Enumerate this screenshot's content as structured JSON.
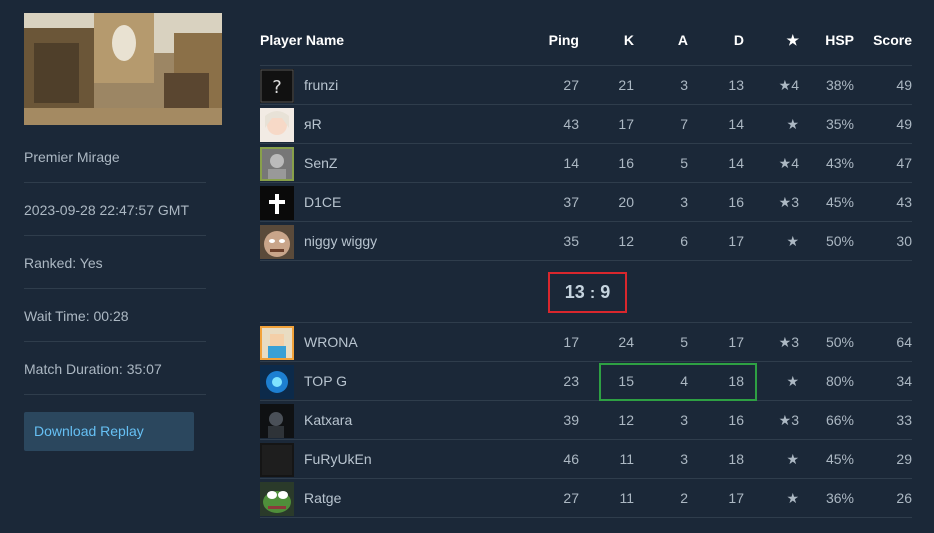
{
  "match": {
    "map_name": "Premier Mirage",
    "date": "2023-09-28 22:47:57 GMT",
    "ranked": "Ranked: Yes",
    "wait_time": "Wait Time: 00:28",
    "duration": "Match Duration: 35:07",
    "download_label": "Download Replay"
  },
  "columns": {
    "player": "Player Name",
    "ping": "Ping",
    "k": "K",
    "a": "A",
    "d": "D",
    "star": "★",
    "hsp": "HSP",
    "score": "Score"
  },
  "score": {
    "left": "13",
    "sep": ":",
    "right": "9"
  },
  "team1": [
    {
      "name": "frunzi",
      "ping": "27",
      "k": "21",
      "a": "3",
      "d": "13",
      "mvp": "★4",
      "hsp": "38%",
      "score": "49"
    },
    {
      "name": "яR",
      "ping": "43",
      "k": "17",
      "a": "7",
      "d": "14",
      "mvp": "★",
      "hsp": "35%",
      "score": "49"
    },
    {
      "name": "SenZ",
      "ping": "14",
      "k": "16",
      "a": "5",
      "d": "14",
      "mvp": "★4",
      "hsp": "43%",
      "score": "47"
    },
    {
      "name": "D1CE",
      "ping": "37",
      "k": "20",
      "a": "3",
      "d": "16",
      "mvp": "★3",
      "hsp": "45%",
      "score": "43"
    },
    {
      "name": "niggy wiggy",
      "ping": "35",
      "k": "12",
      "a": "6",
      "d": "17",
      "mvp": "★",
      "hsp": "50%",
      "score": "30"
    }
  ],
  "team2": [
    {
      "name": "WRONA",
      "ping": "17",
      "k": "24",
      "a": "5",
      "d": "17",
      "mvp": "★3",
      "hsp": "50%",
      "score": "64"
    },
    {
      "name": "TOP G",
      "ping": "23",
      "k": "15",
      "a": "4",
      "d": "18",
      "mvp": "★",
      "hsp": "80%",
      "score": "34"
    },
    {
      "name": "Katxara",
      "ping": "39",
      "k": "12",
      "a": "3",
      "d": "16",
      "mvp": "★3",
      "hsp": "66%",
      "score": "33"
    },
    {
      "name": "FuRyUkEn",
      "ping": "46",
      "k": "11",
      "a": "3",
      "d": "18",
      "mvp": "★",
      "hsp": "45%",
      "score": "29"
    },
    {
      "name": "Ratge",
      "ping": "27",
      "k": "11",
      "a": "2",
      "d": "17",
      "mvp": "★",
      "hsp": "36%",
      "score": "26"
    }
  ],
  "avatars": {
    "team1": [
      "unknown-avatar",
      "anime-girl-avatar",
      "greyscale-avatar",
      "cross-avatar",
      "cartoon-face-avatar"
    ],
    "team2": [
      "pixel-character-avatar",
      "blue-neon-avatar",
      "dark-figure-avatar",
      "dark-avatar",
      "pepe-frog-avatar"
    ]
  },
  "colors": {
    "background": "#1b2838",
    "accent": "#66c0f4",
    "button_bg": "#2b475e",
    "score_highlight": "#d9272d",
    "stats_highlight": "#2ea043"
  }
}
